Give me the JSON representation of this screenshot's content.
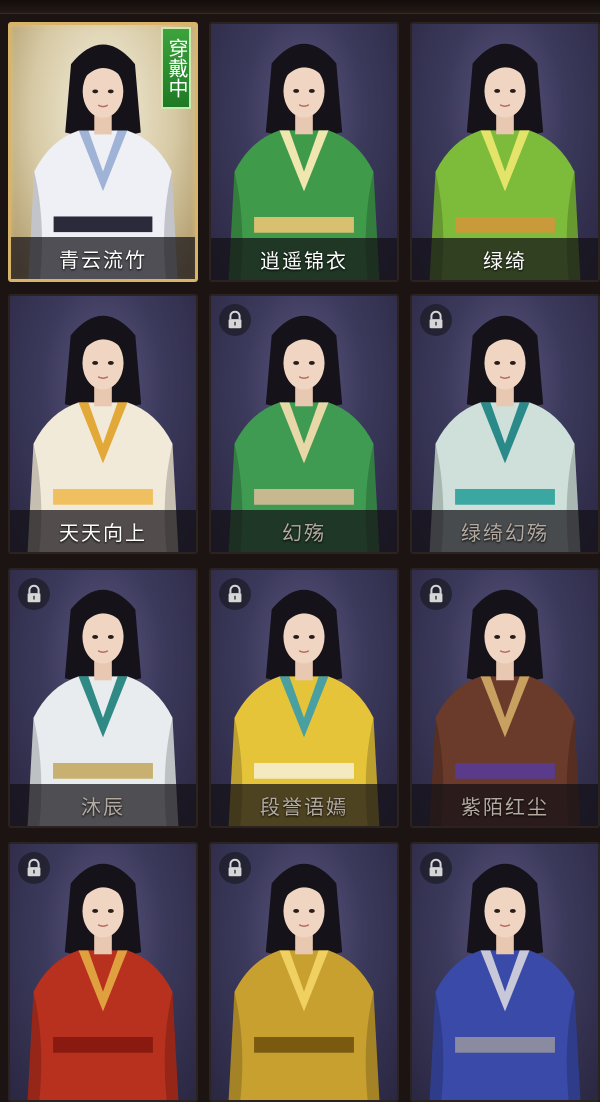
{
  "status_badge": "穿戴中",
  "outfits": [
    {
      "name": "青云流竹",
      "locked": false,
      "selected": true,
      "robe": "#eef0f6",
      "trim": "#9fb3d6",
      "accent": "#2a2a3a"
    },
    {
      "name": "逍遥锦衣",
      "locked": false,
      "selected": false,
      "robe": "#3f9a4a",
      "trim": "#f0e6b0",
      "accent": "#d8c070"
    },
    {
      "name": "绿绮",
      "locked": false,
      "selected": false,
      "robe": "#7dbb3a",
      "trim": "#e4e46a",
      "accent": "#c89a3a"
    },
    {
      "name": "天天向上",
      "locked": false,
      "selected": false,
      "robe": "#f2ead8",
      "trim": "#e2a838",
      "accent": "#f0c060"
    },
    {
      "name": "幻殇",
      "locked": true,
      "selected": false,
      "robe": "#3f9a52",
      "trim": "#e8d8a8",
      "accent": "#c8b890"
    },
    {
      "name": "绿绮幻殇",
      "locked": true,
      "selected": false,
      "robe": "#cfe0da",
      "trim": "#2a8a8a",
      "accent": "#3aa8a0"
    },
    {
      "name": "沐辰",
      "locked": true,
      "selected": false,
      "robe": "#e8ecee",
      "trim": "#2f8a86",
      "accent": "#c8b070"
    },
    {
      "name": "段誉语嫣",
      "locked": true,
      "selected": false,
      "robe": "#e6c43a",
      "trim": "#4aa0a0",
      "accent": "#f4eac0"
    },
    {
      "name": "紫陌红尘",
      "locked": true,
      "selected": false,
      "robe": "#6a3a2a",
      "trim": "#c8a060",
      "accent": "#5a3a8a"
    },
    {
      "name": "",
      "locked": true,
      "selected": false,
      "robe": "#b8301e",
      "trim": "#e0a040",
      "accent": "#8a1a10"
    },
    {
      "name": "",
      "locked": true,
      "selected": false,
      "robe": "#c8a030",
      "trim": "#f0d060",
      "accent": "#7a5a10"
    },
    {
      "name": "",
      "locked": true,
      "selected": false,
      "robe": "#3a4aa8",
      "trim": "#c8c8d8",
      "accent": "#8a8aa0"
    }
  ]
}
